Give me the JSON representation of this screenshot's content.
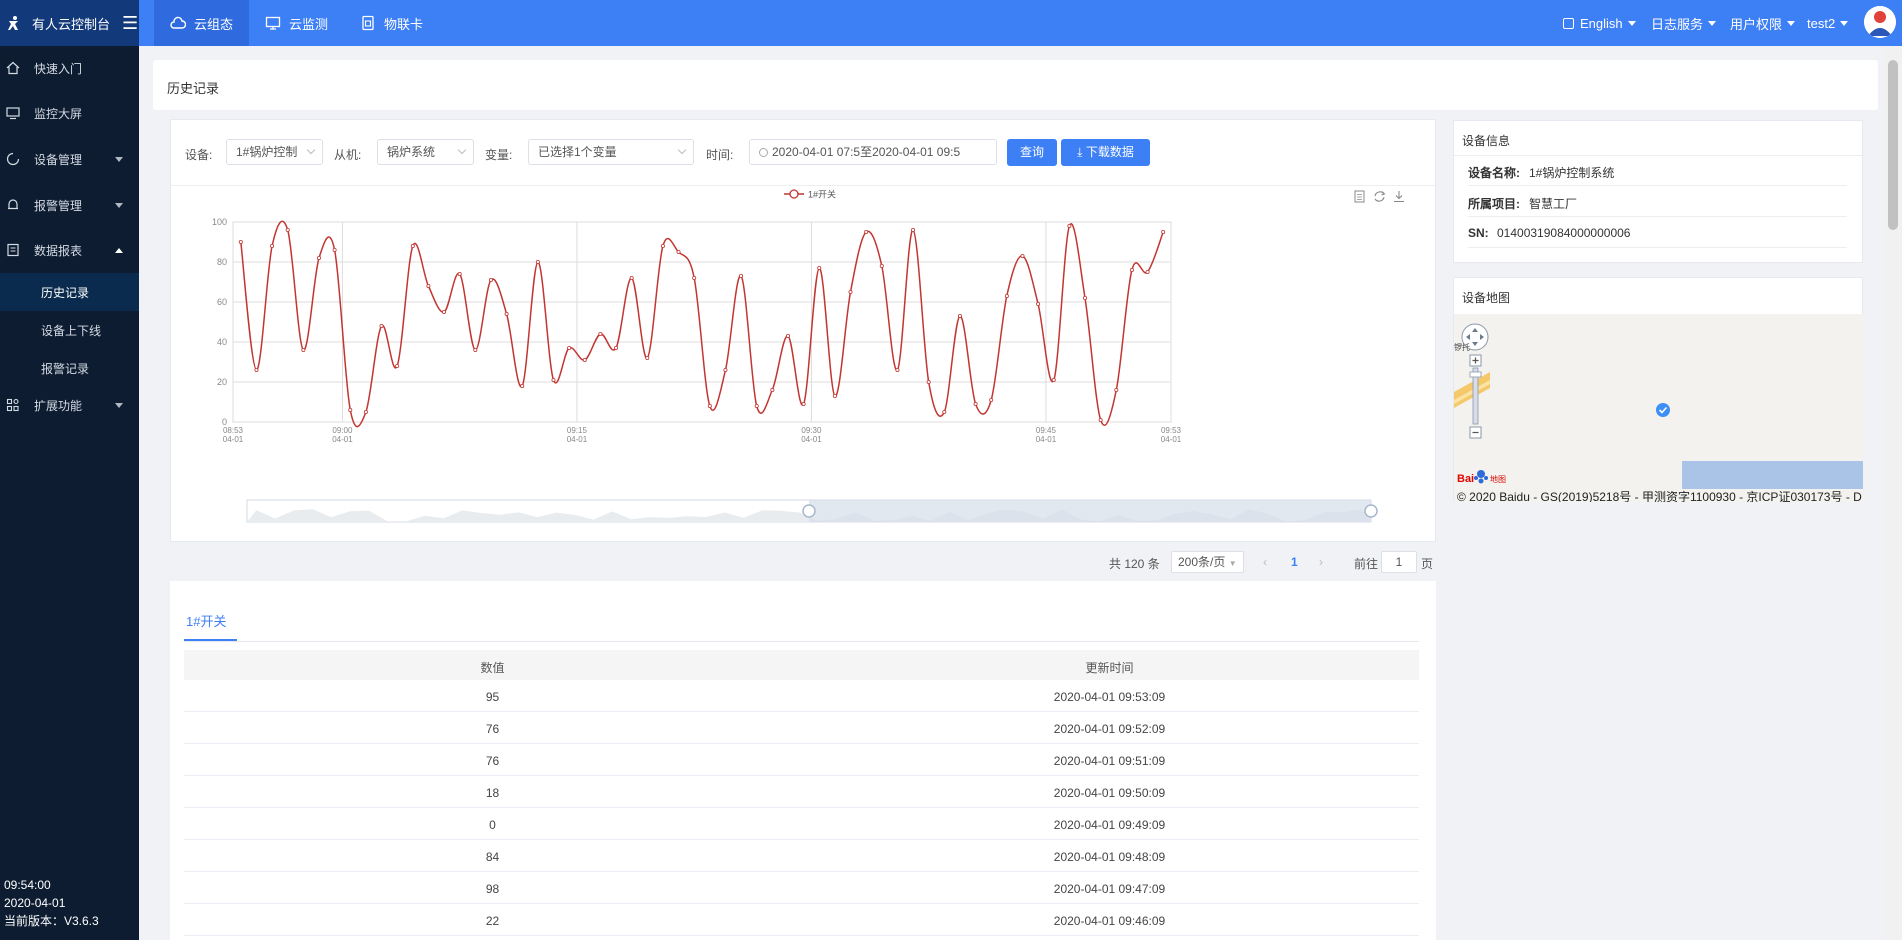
{
  "brand": {
    "title": "有人云控制台"
  },
  "topnav": [
    {
      "label": "云组态",
      "icon": "cloud-icon"
    },
    {
      "label": "云监测",
      "icon": "monitor-icon"
    },
    {
      "label": "物联卡",
      "icon": "sim-card-icon"
    }
  ],
  "topright": {
    "language": "English",
    "logs": "日志服务",
    "permissions": "用户权限",
    "user": "test2"
  },
  "sidebar": {
    "items": [
      {
        "label": "快速入门",
        "icon": "home-icon"
      },
      {
        "label": "监控大屏",
        "icon": "screen-icon"
      },
      {
        "label": "设备管理",
        "icon": "device-icon"
      },
      {
        "label": "报警管理",
        "icon": "bell-icon"
      },
      {
        "label": "数据报表",
        "icon": "report-icon"
      },
      {
        "label": "扩展功能",
        "icon": "extension-icon"
      }
    ],
    "subitems": [
      "历史记录",
      "设备上下线",
      "报警记录"
    ],
    "footer": {
      "time": "09:54:00",
      "date": "2020-04-01",
      "version": "当前版本：V3.6.3"
    }
  },
  "page": {
    "title": "历史记录"
  },
  "filters": {
    "device_label": "设备:",
    "device_value": "1#锅炉控制",
    "slave_label": "从机:",
    "slave_value": "锅炉系统",
    "variable_label": "变量:",
    "variable_value": "已选择1个变量",
    "time_label": "时间:",
    "time_start": "2020-04-01 07:5",
    "time_sep": "至",
    "time_end": "2020-04-01 09:5",
    "query_button": "查询",
    "download_button": "下载数据"
  },
  "chart_data": {
    "type": "line",
    "title": "",
    "legend": [
      "1#开关"
    ],
    "legend_position": "top-center",
    "ylim": [
      0,
      100
    ],
    "yticks": [
      0,
      20,
      40,
      60,
      80,
      100
    ],
    "xlim": [
      "08:53",
      "09:53"
    ],
    "xticks": [
      {
        "time": "08:53",
        "date": "04-01",
        "min": 0
      },
      {
        "time": "09:00",
        "date": "04-01",
        "min": 7
      },
      {
        "time": "09:15",
        "date": "04-01",
        "min": 22
      },
      {
        "time": "09:30",
        "date": "04-01",
        "min": 37
      },
      {
        "time": "09:45",
        "date": "04-01",
        "min": 52
      },
      {
        "time": "09:53",
        "date": "04-01",
        "min": 60
      }
    ],
    "grid": true,
    "series": [
      {
        "name": "1#开关",
        "color": "#c23531",
        "x": [
          0.5,
          1.5,
          2.5,
          3.5,
          4.5,
          5.5,
          6.5,
          7.5,
          8.5,
          9.5,
          10.5,
          11.5,
          12.5,
          13.5,
          14.5,
          15.5,
          16.5,
          17.5,
          18.5,
          19.5,
          20.5,
          21.5,
          22.5,
          23.5,
          24.5,
          25.5,
          26.5,
          27.5,
          28.5,
          29.5,
          30.5,
          31.5,
          32.5,
          33.5,
          34.5,
          35.5,
          36.5,
          37.5,
          38.5,
          39.5,
          40.5,
          41.5,
          42.5,
          43.5,
          44.5,
          45.5,
          46.5,
          47.5,
          48.5,
          49.5,
          50.5,
          51.5,
          52.5,
          53.5,
          54.5,
          55.5,
          56.5,
          57.5,
          58.5,
          59.5
        ],
        "values": [
          90,
          26,
          88,
          96,
          36,
          82,
          86,
          6,
          5,
          48,
          28,
          88,
          68,
          55,
          74,
          36,
          71,
          54,
          18,
          80,
          21,
          37,
          31,
          44,
          37,
          72,
          32,
          88,
          85,
          72,
          8,
          26,
          73,
          8,
          16,
          43,
          9,
          77,
          13,
          65,
          95,
          78,
          26,
          96,
          20,
          5,
          53,
          9,
          11,
          63,
          83,
          59,
          21,
          98,
          62,
          1,
          16,
          76,
          75,
          95
        ]
      }
    ],
    "toolbox": [
      "data-view-icon",
      "restore-icon",
      "save-image-icon"
    ],
    "datazoom": {
      "start": 0.5,
      "end": 1
    }
  },
  "pagination": {
    "total_text": "共 120 条",
    "page_size": "200条/页",
    "current_page": "1",
    "goto_label": "前往",
    "goto_value": "1",
    "page_suffix": "页"
  },
  "table": {
    "tab_label": "1#开关",
    "columns": [
      "数值",
      "更新时间"
    ],
    "rows": [
      {
        "value": "95",
        "time": "2020-04-01 09:53:09"
      },
      {
        "value": "76",
        "time": "2020-04-01 09:52:09"
      },
      {
        "value": "76",
        "time": "2020-04-01 09:51:09"
      },
      {
        "value": "18",
        "time": "2020-04-01 09:50:09"
      },
      {
        "value": "0",
        "time": "2020-04-01 09:49:09"
      },
      {
        "value": "84",
        "time": "2020-04-01 09:48:09"
      },
      {
        "value": "98",
        "time": "2020-04-01 09:47:09"
      },
      {
        "value": "22",
        "time": "2020-04-01 09:46:09"
      }
    ]
  },
  "device_info": {
    "header": "设备信息",
    "rows": [
      {
        "key": "设备名称:",
        "value": "1#锅炉控制系统"
      },
      {
        "key": "所属项目:",
        "value": "智慧工厂"
      },
      {
        "key": "SN:",
        "value": "01400319084000000006"
      }
    ]
  },
  "device_map": {
    "header": "设备地图",
    "edge_text": "锣托",
    "copyright": "© 2020 Baidu - GS(2019)5218号 - 甲测资字1100930 - 京ICP证030173号 - D",
    "logo_text": "Bai",
    "logo_suffix": "地图"
  },
  "colors": {
    "accent": "#3d7ff5",
    "sidebar_bg": "#0d1c30",
    "line": "#c23531"
  }
}
